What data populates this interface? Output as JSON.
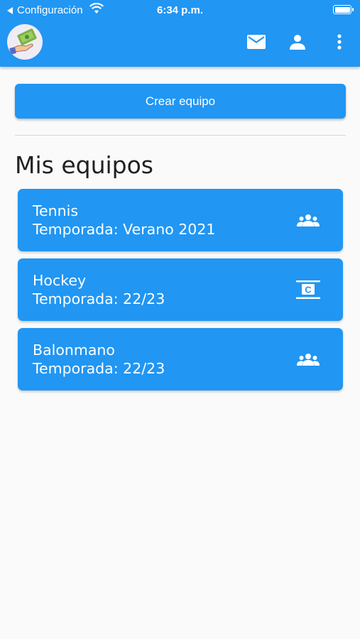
{
  "status_bar": {
    "back_label": "Configuración",
    "time": "6:34 p.m."
  },
  "app_bar": {
    "logo_icon": "money-hand-icon",
    "actions": [
      "mail-icon",
      "person-icon",
      "more-vert-icon"
    ]
  },
  "main": {
    "create_button_label": "Crear equipo",
    "section_title": "Mis equipos",
    "teams": [
      {
        "name": "Tennis",
        "season": "Temporada: Verano 2021",
        "icon": "groups-icon"
      },
      {
        "name": "Hockey",
        "season": "Temporada: 22/23",
        "icon": "closed-caption-icon"
      },
      {
        "name": "Balonmano",
        "season": "Temporada: 22/23",
        "icon": "groups-icon"
      }
    ]
  },
  "colors": {
    "primary": "#2196f3",
    "background": "#fafafa",
    "text": "#212121"
  }
}
